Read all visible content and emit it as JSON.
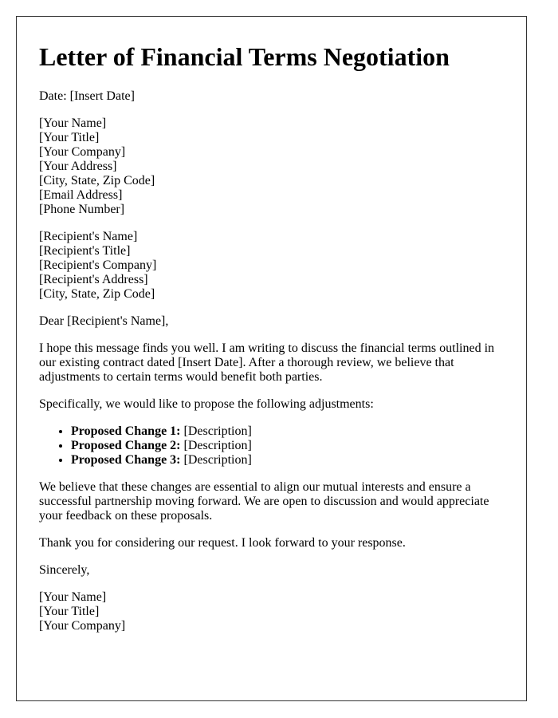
{
  "title": "Letter of Financial Terms Negotiation",
  "date_line": "Date: [Insert Date]",
  "sender": [
    "[Your Name]",
    "[Your Title]",
    "[Your Company]",
    "[Your Address]",
    "[City, State, Zip Code]",
    "[Email Address]",
    "[Phone Number]"
  ],
  "recipient": [
    "[Recipient's Name]",
    "[Recipient's Title]",
    "[Recipient's Company]",
    "[Recipient's Address]",
    "[City, State, Zip Code]"
  ],
  "salutation": "Dear [Recipient's Name],",
  "intro": "I hope this message finds you well. I am writing to discuss the financial terms outlined in our existing contract dated [Insert Date]. After a thorough review, we believe that adjustments to certain terms would benefit both parties.",
  "lead_in": "Specifically, we would like to propose the following adjustments:",
  "changes": [
    {
      "label": "Proposed Change 1:",
      "text": " [Description]"
    },
    {
      "label": "Proposed Change 2:",
      "text": " [Description]"
    },
    {
      "label": "Proposed Change 3:",
      "text": " [Description]"
    }
  ],
  "body2": "We believe that these changes are essential to align our mutual interests and ensure a successful partnership moving forward. We are open to discussion and would appreciate your feedback on these proposals.",
  "thanks": "Thank you for considering our request. I look forward to your response.",
  "closing": "Sincerely,",
  "signature": [
    "[Your Name]",
    "[Your Title]",
    "[Your Company]"
  ]
}
